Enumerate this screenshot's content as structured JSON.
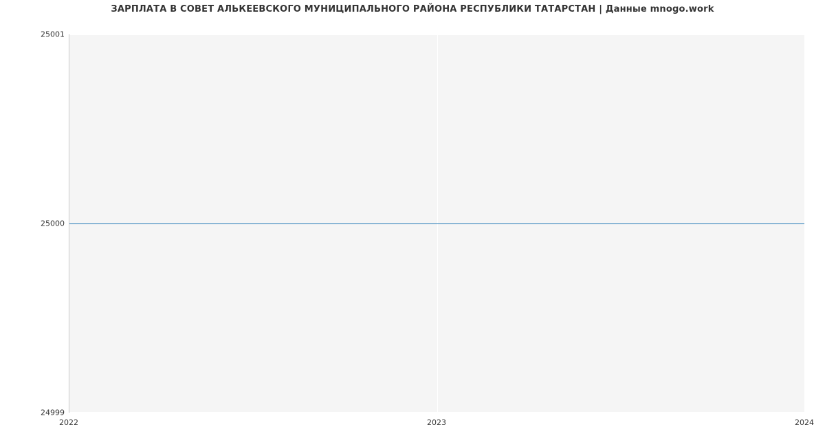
{
  "chart_data": {
    "type": "line",
    "title": "ЗАРПЛАТА В СОВЕТ АЛЬКЕЕВСКОГО МУНИЦИПАЛЬНОГО РАЙОНА РЕСПУБЛИКИ ТАТАРСТАН | Данные mnogo.work",
    "xlabel": "",
    "ylabel": "",
    "x": [
      2022,
      2023,
      2024
    ],
    "x_ticks": [
      "2022",
      "2023",
      "2024"
    ],
    "y_ticks": [
      "24999",
      "25000",
      "25001"
    ],
    "ylim": [
      24999,
      25001
    ],
    "xlim": [
      2022,
      2024
    ],
    "series": [
      {
        "name": "salary",
        "values": [
          25000,
          25000,
          25000
        ]
      }
    ]
  }
}
